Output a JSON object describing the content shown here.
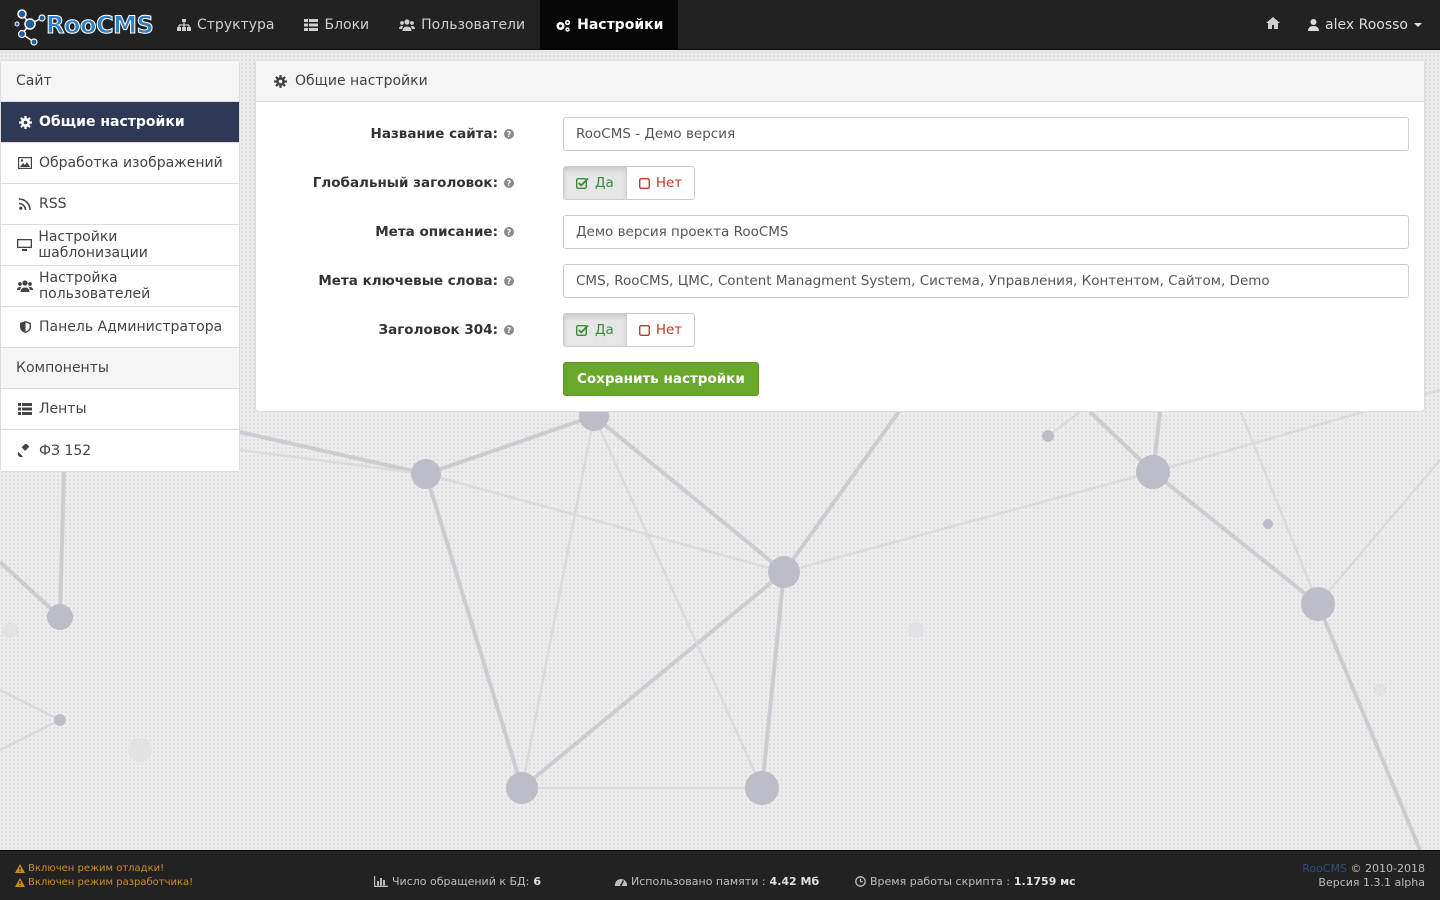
{
  "brand": {
    "name": "RooCMS"
  },
  "nav": {
    "items": [
      {
        "label": "Структура",
        "icon": "sitemap-icon"
      },
      {
        "label": "Блоки",
        "icon": "grid-icon"
      },
      {
        "label": "Пользователи",
        "icon": "users-icon"
      },
      {
        "label": "Настройки",
        "icon": "cogs-icon",
        "active": true
      }
    ],
    "user": "alex Roosso"
  },
  "sidebar": {
    "section1": "Сайт",
    "items1": [
      {
        "label": "Общие настройки",
        "icon": "cog-icon",
        "active": true
      },
      {
        "label": "Обработка изображений",
        "icon": "image-icon"
      },
      {
        "label": "RSS",
        "icon": "rss-icon"
      },
      {
        "label": "Настройки шаблонизации",
        "icon": "monitor-icon"
      },
      {
        "label": "Настройка пользователей",
        "icon": "users-icon"
      },
      {
        "label": "Панель Администратора",
        "icon": "shield-icon"
      }
    ],
    "section2": "Компоненты",
    "items2": [
      {
        "label": "Ленты",
        "icon": "list-icon"
      },
      {
        "label": "ФЗ 152",
        "icon": "gavel-icon"
      }
    ]
  },
  "panel": {
    "title": "Общие настройки",
    "fields": {
      "site_name": {
        "label": "Название сайта:",
        "value": "RooCMS - Демо версия"
      },
      "global_title": {
        "label": "Глобальный заголовок:",
        "yes": "Да",
        "no": "Нет",
        "selected": "Да"
      },
      "meta_desc": {
        "label": "Мета описание:",
        "value": "Демо версия проекта RooCMS"
      },
      "meta_keys": {
        "label": "Мета ключевые слова:",
        "value": "CMS, RooCMS, ЦМС, Content Managment System, Система, Управления, Контентом, Сайтом, Demo"
      },
      "header_304": {
        "label": "Заголовок 304:",
        "yes": "Да",
        "no": "Нет",
        "selected": "Да"
      }
    },
    "save_label": "Сохранить настройки"
  },
  "footer": {
    "debug": "Включен режим отладки!",
    "dev": "Включен режим разработчика!",
    "db_label": "Число обращений к БД:",
    "db_value": "6",
    "mem_label": "Использовано памяти :",
    "mem_value": "4.42 Мб",
    "time_label": "Время работы скрипта :",
    "time_value": "1.1759 мс",
    "copy_brand": "RooCMS",
    "copy_years": "© 2010-2018",
    "version": "Версия 1.3.1 alpha"
  },
  "colors": {
    "navbar": "#222222",
    "active_sidebar": "#2e3a55",
    "save_button": "#6aa82c",
    "warning": "#d08c26"
  }
}
